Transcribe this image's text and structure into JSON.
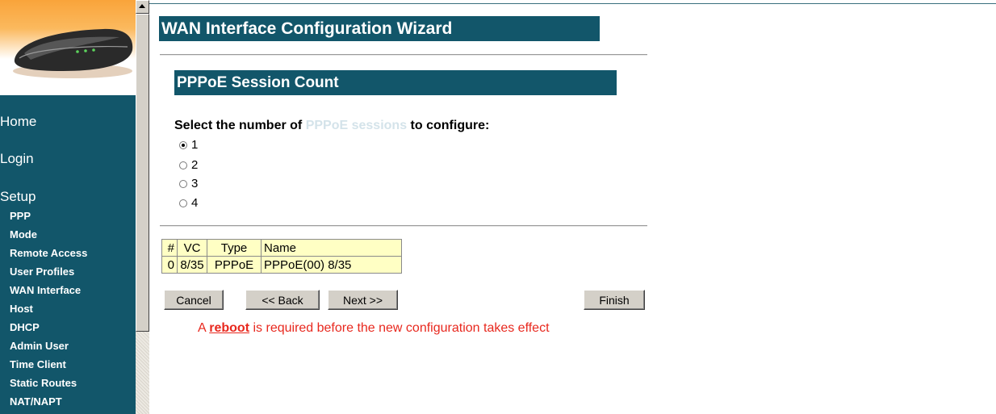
{
  "sidebar": {
    "main_items": [
      {
        "label": "Home"
      },
      {
        "label": "Login"
      },
      {
        "label": "Setup"
      }
    ],
    "sub_items": [
      {
        "label": "PPP"
      },
      {
        "label": "Mode"
      },
      {
        "label": "Remote Access"
      },
      {
        "label": "User Profiles"
      },
      {
        "label": "WAN Interface"
      },
      {
        "label": "Host"
      },
      {
        "label": "DHCP"
      },
      {
        "label": "Admin User"
      },
      {
        "label": "Time Client"
      },
      {
        "label": "Static Routes"
      },
      {
        "label": "NAT/NAPT"
      }
    ]
  },
  "main": {
    "wizard_title": "WAN Interface Configuration Wizard",
    "section_title": "PPPoE Session Count",
    "prompt": {
      "before": "Select the number of",
      "highlight": "PPPoE sessions",
      "after": "to configure:"
    },
    "options": [
      {
        "label": "1",
        "selected": true
      },
      {
        "label": "2",
        "selected": false
      },
      {
        "label": "3",
        "selected": false
      },
      {
        "label": "4",
        "selected": false
      }
    ],
    "table": {
      "headers": [
        "#",
        "VC",
        "Type",
        "Name"
      ],
      "rows": [
        [
          "0",
          "8/35",
          "PPPoE",
          "PPPoE(00) 8/35"
        ]
      ]
    },
    "buttons": {
      "cancel": "Cancel",
      "back": "<< Back",
      "next": "Next >>",
      "finish": "Finish"
    },
    "reboot": {
      "prefix": "A",
      "link": "reboot",
      "suffix": "is required before the new configuration takes effect"
    }
  },
  "colors": {
    "panel": "#12566a",
    "table_bg": "#ffffc4",
    "alert": "#e8281e"
  }
}
